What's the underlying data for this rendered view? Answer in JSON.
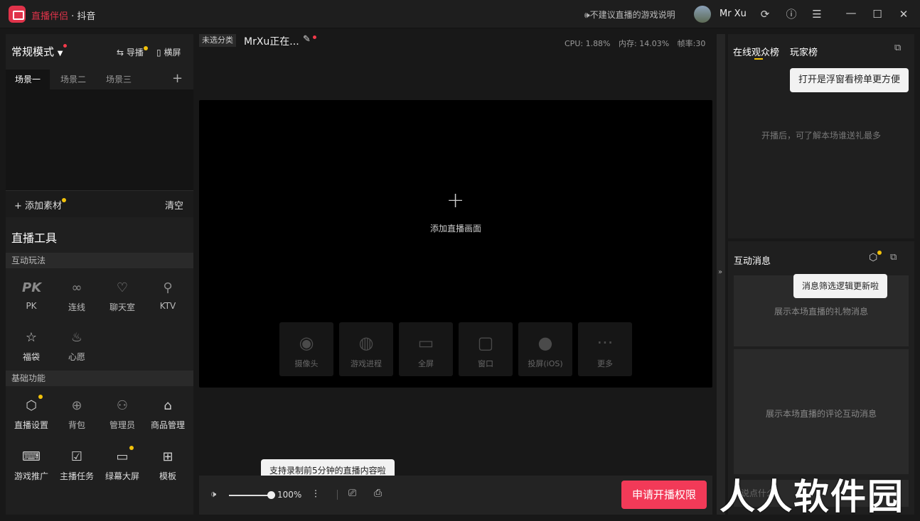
{
  "titlebar": {
    "app_name": "直播伴侣",
    "platform": " · 抖音",
    "notice": "不建议直播的游戏说明",
    "username": "Mr Xu"
  },
  "left": {
    "mode": "常规模式",
    "guide_label": "导播",
    "landscape_label": "横屏",
    "scenes": [
      "场景一",
      "场景二",
      "场景三"
    ],
    "add_material": "添加素材",
    "clear": "清空",
    "tools_title": "直播工具",
    "interactive_section": "互动玩法",
    "interactive_tools": [
      "PK",
      "连线",
      "聊天室",
      "KTV",
      "福袋",
      "心愿"
    ],
    "basic_section": "基础功能",
    "basic_tools": [
      "直播设置",
      "背包",
      "管理员",
      "商品管理",
      "游戏推广",
      "主播任务",
      "绿幕大屏",
      "模板"
    ]
  },
  "center": {
    "category_badge": "未选分类",
    "stream_title": "MrXu正在...",
    "cpu": "CPU: 1.88%",
    "memory": "内存: 14.03%",
    "fps": "帧率:30",
    "add_scene": "添加直播画面",
    "sources": [
      "摄像头",
      "游戏进程",
      "全屏",
      "窗口",
      "投屏(iOS)",
      "更多"
    ],
    "volume_percent": "100%",
    "volume_level": 1.0,
    "record_tooltip": "支持录制前5分钟的直播内容啦",
    "apply_button": "申请开播权限",
    "comment_placeholder": "说点什么"
  },
  "right": {
    "tab_online": "在线观众榜",
    "tab_players": "玩家榜",
    "float_tooltip": "打开是浮窗看榜单更方便",
    "audience_empty": "开播后，可了解本场谁送礼最多",
    "messages_title": "互动消息",
    "filter_tooltip": "消息筛选逻辑更新啦",
    "gift_empty": "展示本场直播的礼物消息",
    "comment_empty": "展示本场直播的评论互动消息"
  },
  "watermark": "人人软件园",
  "colors": {
    "accent": "#e0334a",
    "apply_button": "#f23a58",
    "notice_dot": "#f2c20a"
  }
}
